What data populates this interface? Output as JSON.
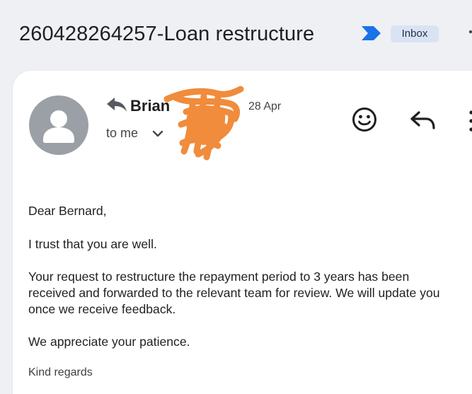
{
  "header": {
    "subject": "260428264257-Loan restructure",
    "label": "Inbox",
    "importance_icon": "importance-marker-icon",
    "more_icon": "more-vert-icon"
  },
  "message": {
    "sender_name": "Brian",
    "date_fragment": "28 Apr",
    "recipient_label": "to me",
    "avatar_icon": "default-avatar-icon",
    "sender_reply_icon": "reply-indicator-icon",
    "actions": {
      "emoji_icon": "emoji-react-icon",
      "reply_icon": "reply-icon",
      "more_icon": "more-vert-icon"
    },
    "redaction_color": "#f08c3c"
  },
  "body": {
    "greeting": "Dear Bernard,",
    "line1": "I trust that you are well.",
    "para2_line1": "Your request to restructure the repayment period to 3 years has been",
    "para2_line2": "received and forwarded to the relevant team for review. We will update you",
    "para2_line3": "once we receive feedback.",
    "line3": "We appreciate your patience.",
    "closing": "Kind regards"
  },
  "colors": {
    "background": "#eef0f4",
    "card": "#ffffff",
    "importance_blue": "#1a73e8",
    "chip_bg": "#d9e3f4",
    "avatar_gray": "#9aa0a6"
  }
}
